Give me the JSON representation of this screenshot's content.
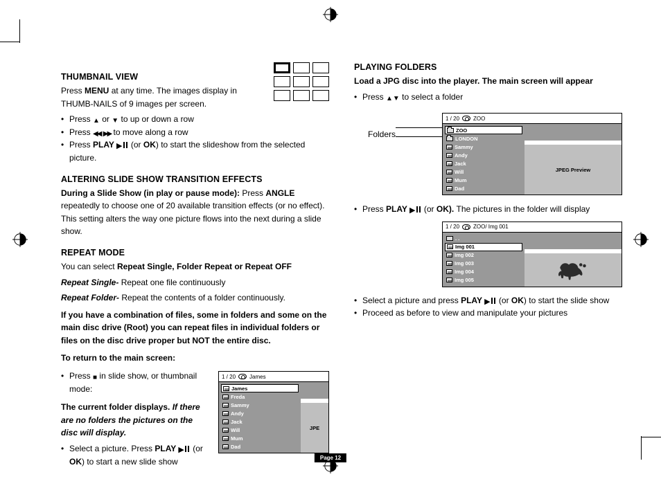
{
  "page_number_label": "Page 12",
  "left": {
    "h_thumb": "THUMBNAIL VIEW",
    "thumb_p1a": "Press ",
    "thumb_p1b": "MENU",
    "thumb_p1c": " at any time. The images display in THUMB-NAILS of 9 images per screen.",
    "thumb_li1a": "Press ",
    "thumb_li1b": " or ",
    "thumb_li1c": " to up or down a row",
    "thumb_li2a": "Press ",
    "thumb_li2b": " to move along a row",
    "thumb_li3a": "Press ",
    "thumb_li3b": "PLAY ",
    "thumb_li3c": " (or ",
    "thumb_li3d": "OK",
    "thumb_li3e": ") to start the slideshow from the selected picture.",
    "h_alter": "ALTERING SLIDE SHOW TRANSITION EFFECTS",
    "alter_p1a": "During a Slide Show (in play or pause mode):",
    "alter_p1b": " Press ",
    "alter_p1c": "ANGLE",
    "alter_p1d": " repeatedly to choose one of 20 available transition effects (or no effect). This setting alters the way one picture flows into the next during a slide show.",
    "h_repeat": "REPEAT MODE",
    "repeat_p1a": "You can select ",
    "repeat_p1b": "Repeat Single, Folder Repeat or Repeat OFF",
    "repeat_p2a": "Repeat Single-",
    "repeat_p2b": " Repeat one file continuously",
    "repeat_p3a": "Repeat Folder-",
    "repeat_p3b": " Repeat the contents of a folder continuously.",
    "repeat_p4": "If you have a combination of files, some in folders and some on the main disc drive (Root) you can repeat files in individual folders or files on the disc drive proper but NOT the entire disc.",
    "repeat_p5": "To return to the main screen:",
    "repeat_li1a": "Press ",
    "repeat_li1b": " in slide show, or thumbnail mode:",
    "repeat_p6a": "The current folder displays. ",
    "repeat_p6b": "If there are no folders the pictures on the disc will display.",
    "repeat_li2a": "Select a picture. Press ",
    "repeat_li2b": "PLAY ",
    "repeat_li2c": " (or ",
    "repeat_li2d": "OK",
    "repeat_li2e": ") to start a new slide show",
    "browser1": {
      "counter": "1 /   20",
      "path": "James",
      "items": [
        "James",
        "Freda",
        "Sammy",
        "Andy",
        "Jack",
        "Will",
        "Mum",
        "Dad"
      ],
      "preview": "JPE"
    }
  },
  "right": {
    "h_play": "PLAYING FOLDERS",
    "play_p1": "Load a JPG disc into the player. The main screen will appear",
    "play_li1a": "Press ",
    "play_li1b": " to select a folder",
    "callout": "Folders",
    "browser2": {
      "counter": "1 /   20",
      "path": "ZOO",
      "items": [
        "ZOO",
        "LONDON",
        "Sammy",
        "Andy",
        "Jack",
        "Will",
        "Mum",
        "Dad"
      ],
      "preview": "JPEG Preview",
      "folder_flags": [
        true,
        true,
        false,
        false,
        false,
        false,
        false,
        false
      ]
    },
    "play_li2a": "Press ",
    "play_li2b": "PLAY ",
    "play_li2c": " (or ",
    "play_li2d": "OK",
    "play_li2e": "). ",
    "play_li2f": "The pictures in the folder will display",
    "browser3": {
      "counter": "1 /   20",
      "path": "ZOO/ Img 001",
      "up": ". .",
      "items": [
        "Img 001",
        "Img 002",
        "Img 003",
        "Img 004",
        "Img 005"
      ]
    },
    "play_li3a": "Select a picture and press ",
    "play_li3b": "PLAY ",
    "play_li3c": " (or ",
    "play_li3d": "OK",
    "play_li3e": ") to start the slide show",
    "play_li4": "Proceed as before to view and manipulate your pictures"
  }
}
